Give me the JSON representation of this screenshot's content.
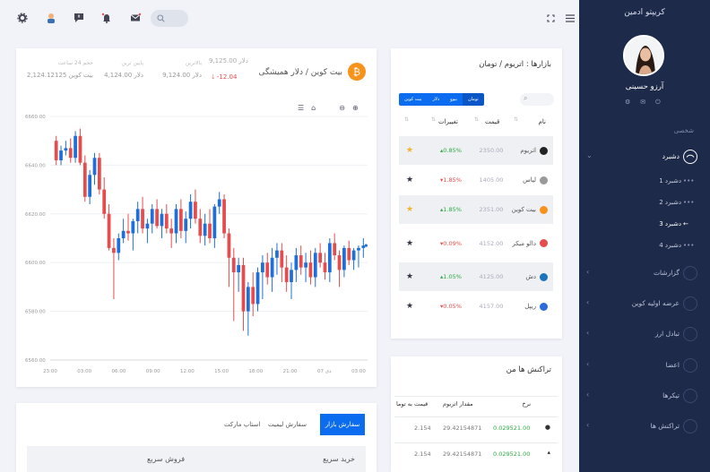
{
  "sidebar": {
    "title": "کریپتو ادمین",
    "user_name": "آرزو حسینی",
    "section_personal": "شخصی",
    "dashboard": "دشبرد",
    "sub_items": [
      "دشبرد 1",
      "دشبرد 2",
      "دشبرد 3",
      "دشبرد 4"
    ],
    "items": [
      "گزارشات",
      "عرضه اولیه کوین",
      "تبادل ارز",
      "اعضا",
      "تیکرها",
      "تراکنش ها"
    ]
  },
  "ticker": {
    "coin_name": "بیت کوین / دلار همیشگی",
    "change": "-12.04",
    "price_label": "9,125.00 دلار",
    "high_label": "بالاترین",
    "high_value": "9,124.00 دلار",
    "low_label": "پایین ترین",
    "low_value": "4,124.00 دلار",
    "volume_label": "حجم 24 ساعت",
    "volume_value": "2,124.12125 بیت کوین"
  },
  "chart_data": {
    "type": "candlestick",
    "y_ticks": [
      "6660.00",
      "6640.00",
      "6620.00",
      "6600.00",
      "6580.00",
      "6560.00"
    ],
    "x_ticks": [
      "23:00",
      "03:00",
      "06:00",
      "09:00",
      "12:00",
      "15:00",
      "18:00",
      "21:00",
      "دی 07",
      "03:00"
    ],
    "ylim": [
      6560,
      6660
    ],
    "up_color": "#1e6fd9",
    "down_color": "#e74c4c",
    "candles": [
      [
        6650,
        6652,
        6640,
        6642
      ],
      [
        6642,
        6648,
        6640,
        6646
      ],
      [
        6646,
        6650,
        6644,
        6647
      ],
      [
        6647,
        6651,
        6641,
        6643
      ],
      [
        6643,
        6654,
        6641,
        6652
      ],
      [
        6652,
        6655,
        6640,
        6641
      ],
      [
        6641,
        6644,
        6625,
        6627
      ],
      [
        6627,
        6638,
        6624,
        6636
      ],
      [
        6636,
        6645,
        6632,
        6643
      ],
      [
        6643,
        6645,
        6628,
        6630
      ],
      [
        6630,
        6635,
        6618,
        6620
      ],
      [
        6620,
        6624,
        6605,
        6606
      ],
      [
        6606,
        6610,
        6585,
        6604
      ],
      [
        6604,
        6612,
        6601,
        6610
      ],
      [
        6610,
        6618,
        6608,
        6613
      ],
      [
        6613,
        6620,
        6609,
        6612
      ],
      [
        6612,
        6618,
        6605,
        6617
      ],
      [
        6617,
        6625,
        6612,
        6622
      ],
      [
        6622,
        6627,
        6612,
        6614
      ],
      [
        6614,
        6618,
        6608,
        6616
      ],
      [
        6616,
        6624,
        6612,
        6622
      ],
      [
        6622,
        6626,
        6614,
        6615
      ],
      [
        6615,
        6622,
        6610,
        6620
      ],
      [
        6620,
        6624,
        6612,
        6614
      ],
      [
        6614,
        6618,
        6606,
        6612
      ],
      [
        6612,
        6624,
        6608,
        6622
      ],
      [
        6622,
        6626,
        6610,
        6613
      ],
      [
        6613,
        6621,
        6608,
        6618
      ],
      [
        6618,
        6628,
        6614,
        6625
      ],
      [
        6625,
        6630,
        6616,
        6618
      ],
      [
        6618,
        6622,
        6608,
        6611
      ],
      [
        6611,
        6620,
        6607,
        6616
      ],
      [
        6616,
        6622,
        6608,
        6610
      ],
      [
        6610,
        6624,
        6606,
        6623
      ],
      [
        6623,
        6629,
        6620,
        6626
      ],
      [
        6626,
        6628,
        6610,
        6612
      ],
      [
        6612,
        6614,
        6590,
        6602
      ],
      [
        6602,
        6606,
        6576,
        6596
      ],
      [
        6596,
        6602,
        6588,
        6599
      ],
      [
        6599,
        6602,
        6572,
        6580
      ],
      [
        6580,
        6592,
        6570,
        6590
      ],
      [
        6590,
        6596,
        6578,
        6583
      ],
      [
        6583,
        6598,
        6580,
        6596
      ],
      [
        6596,
        6603,
        6585,
        6600
      ],
      [
        6600,
        6604,
        6591,
        6594
      ],
      [
        6594,
        6606,
        6588,
        6602
      ],
      [
        6602,
        6608,
        6595,
        6605
      ],
      [
        6605,
        6608,
        6592,
        6598
      ],
      [
        6598,
        6603,
        6588,
        6592
      ],
      [
        6592,
        6600,
        6585,
        6597
      ],
      [
        6597,
        6606,
        6592,
        6603
      ],
      [
        6603,
        6607,
        6595,
        6598
      ],
      [
        6598,
        6604,
        6592,
        6600
      ],
      [
        6600,
        6605,
        6591,
        6594
      ],
      [
        6594,
        6606,
        6590,
        6604
      ],
      [
        6604,
        6608,
        6598,
        6600
      ],
      [
        6600,
        6604,
        6593,
        6596
      ],
      [
        6596,
        6610,
        6592,
        6608
      ],
      [
        6608,
        6612,
        6601,
        6603
      ],
      [
        6603,
        6605,
        6590,
        6597
      ],
      [
        6597,
        6607,
        6594,
        6606
      ],
      [
        6606,
        6609,
        6599,
        6601
      ],
      [
        6601,
        6606,
        6597,
        6605
      ],
      [
        6605,
        6607,
        6598,
        6606
      ],
      [
        6606,
        6610,
        6602,
        6607
      ]
    ]
  },
  "markets": {
    "title": "بازارها : اتریوم / تومان",
    "tabs": [
      "تومان",
      "بیوو",
      "دلار",
      "بیت کوین"
    ],
    "col_name": "نام",
    "col_price": "قیمت",
    "col_change": "تغییرات",
    "rows": [
      {
        "name": "اتریوم",
        "price": "2350.00",
        "change": "0.85%",
        "dir": "up",
        "starred": true,
        "color": "#222"
      },
      {
        "name": "لیاس",
        "price": "1405.00",
        "change": "1.85%",
        "dir": "down",
        "starred": false,
        "color": "#999"
      },
      {
        "name": "بیت کوین",
        "price": "2351.00",
        "change": "1.85%",
        "dir": "up",
        "starred": true,
        "color": "#f7931a"
      },
      {
        "name": "دالو میکر",
        "price": "4152.00",
        "change": "0.09%",
        "dir": "down",
        "starred": false,
        "color": "#e74c4c"
      },
      {
        "name": "دش",
        "price": "4125.00",
        "change": "1.05%",
        "dir": "up",
        "starred": false,
        "color": "#1c75bc"
      },
      {
        "name": "ریپل",
        "price": "4157.00",
        "change": "0.05%",
        "dir": "down",
        "starred": false,
        "color": "#2b6bdc"
      }
    ]
  },
  "transactions": {
    "title": "تراکنش ها من",
    "col_rate": "نرخ",
    "col_amount": "مقدار اتریوم",
    "col_toman": "قیمت به توما",
    "rows": [
      {
        "rate": "0.029521.00",
        "amount": "29.42154871",
        "toman": "2.154"
      },
      {
        "rate": "0.029521.00",
        "amount": "29.42154871",
        "toman": "2.154"
      }
    ]
  },
  "order": {
    "tab_market": "سفارش بازار",
    "tab_limit": "سفارش لیمیت",
    "tab_stop": "استاپ مارکت",
    "buy": "خرید سریع",
    "sell": "فروش سریع"
  }
}
